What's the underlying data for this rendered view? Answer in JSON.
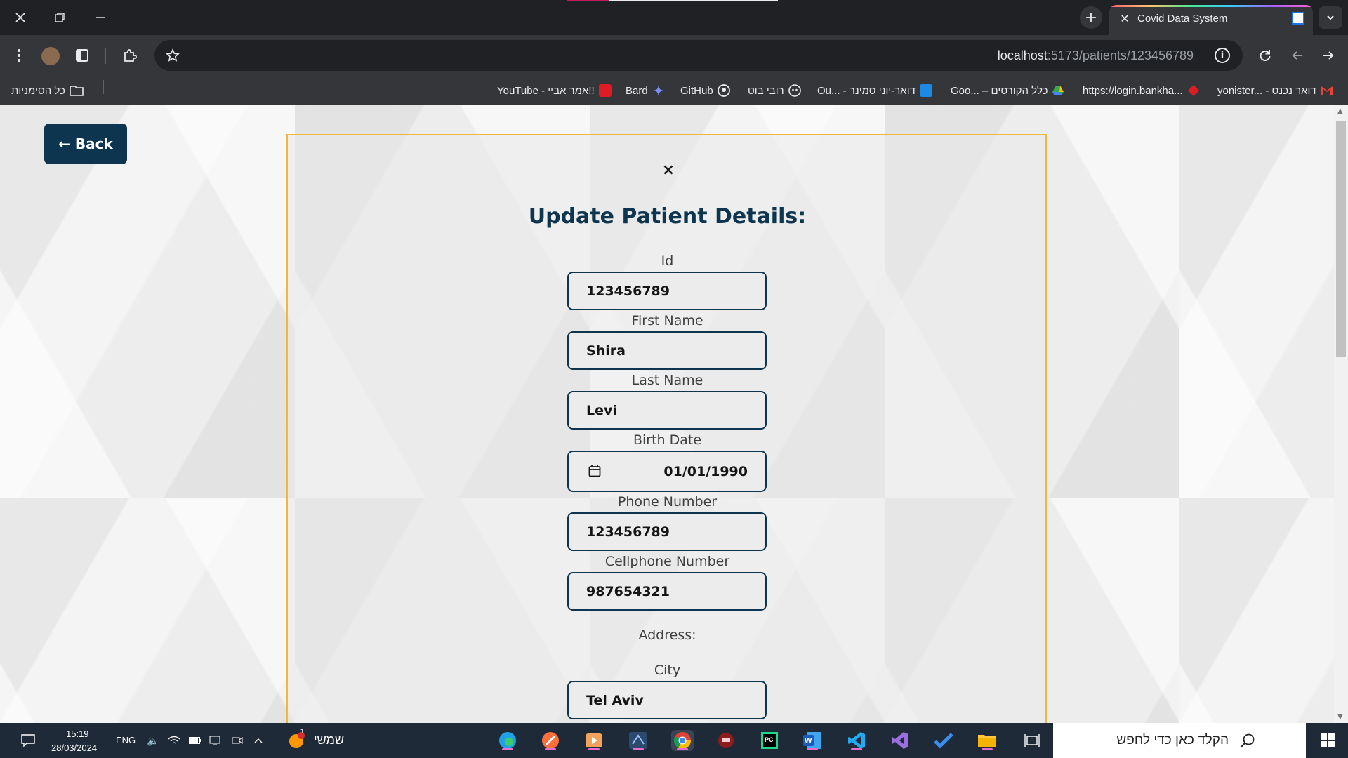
{
  "browser": {
    "tab_title": "Covid Data System",
    "url_host": "localhost",
    "url_path": ":5173/patients/123456789",
    "all_bookmarks_label": "כל הסימניות",
    "bookmarks": [
      {
        "label": "YouTube - אמר אביי!!",
        "color": "#e01b24"
      },
      {
        "label": "Bard",
        "color": "#7c8df5"
      },
      {
        "label": "GitHub",
        "color": "#9aa0a6"
      },
      {
        "label": "רובי בוט",
        "color": "#9aa0a6"
      },
      {
        "label": "Ou... - דואר-יוני סמינר",
        "color": "#1e88e5"
      },
      {
        "label": "Goo... – כלל הקורסים",
        "color": "#34a853"
      },
      {
        "label": "https://login.bankha...",
        "color": "#e01b24"
      },
      {
        "label": "yonister... - דואר נכנס",
        "color": "#ea4335"
      }
    ]
  },
  "page": {
    "back_label": "← Back",
    "close_symbol": "×",
    "form_title": "Update Patient Details:",
    "fields": {
      "id_label": "Id",
      "id_value": "123456789",
      "first_name_label": "First Name",
      "first_name_value": "Shira",
      "last_name_label": "Last Name",
      "last_name_value": "Levi",
      "birth_date_label": "Birth Date",
      "birth_date_value": "01/01/1990",
      "phone_label": "Phone Number",
      "phone_value": "123456789",
      "cellphone_label": "Cellphone Number",
      "cellphone_value": "987654321",
      "address_label": "Address:",
      "city_label": "City",
      "city_value": "Tel Aviv"
    }
  },
  "taskbar": {
    "time": "15:19",
    "date": "28/03/2024",
    "language": "ENG",
    "weather_label": "שמשי",
    "search_placeholder": "הקלד כאן כדי לחפש",
    "notification_badge": "1"
  },
  "colors": {
    "primary": "#0e3550",
    "modal_border": "#f0b73e"
  }
}
